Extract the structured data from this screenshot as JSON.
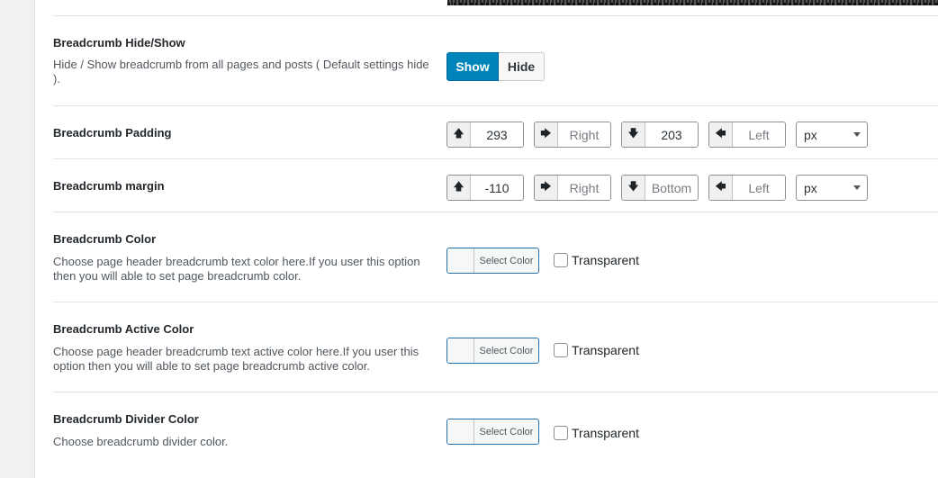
{
  "hide_show": {
    "title": "Breadcrumb Hide/Show",
    "description": "Hide / Show breadcrumb from all pages and posts ( Default settings hide ).",
    "show_label": "Show",
    "hide_label": "Hide",
    "selected": "Show"
  },
  "padding": {
    "title": "Breadcrumb Padding",
    "top_value": "293",
    "right_placeholder": "Right",
    "bottom_value": "203",
    "left_placeholder": "Left",
    "unit": "px"
  },
  "margin": {
    "title": "Breadcrumb margin",
    "top_value": "-110",
    "right_placeholder": "Right",
    "bottom_placeholder": "Bottom",
    "left_placeholder": "Left",
    "unit": "px"
  },
  "color": {
    "title": "Breadcrumb Color",
    "description": "Choose page header breadcrumb text color here.If you user this option then you will able to set page breadcrumb color.",
    "button_label": "Select Color",
    "transparent_label": "Transparent"
  },
  "active_color": {
    "title": "Breadcrumb Active Color",
    "description": "Choose page header breadcrumb text active color here.If you user this option then you will able to set page breadcrumb active color.",
    "button_label": "Select Color",
    "transparent_label": "Transparent"
  },
  "divider_color": {
    "title": "Breadcrumb Divider Color",
    "description": "Choose breadcrumb divider color.",
    "button_label": "Select Color",
    "transparent_label": "Transparent"
  },
  "icons": {
    "up": "arrow-up-icon",
    "right": "arrow-right-icon",
    "down": "arrow-down-icon",
    "left": "arrow-left-icon"
  }
}
